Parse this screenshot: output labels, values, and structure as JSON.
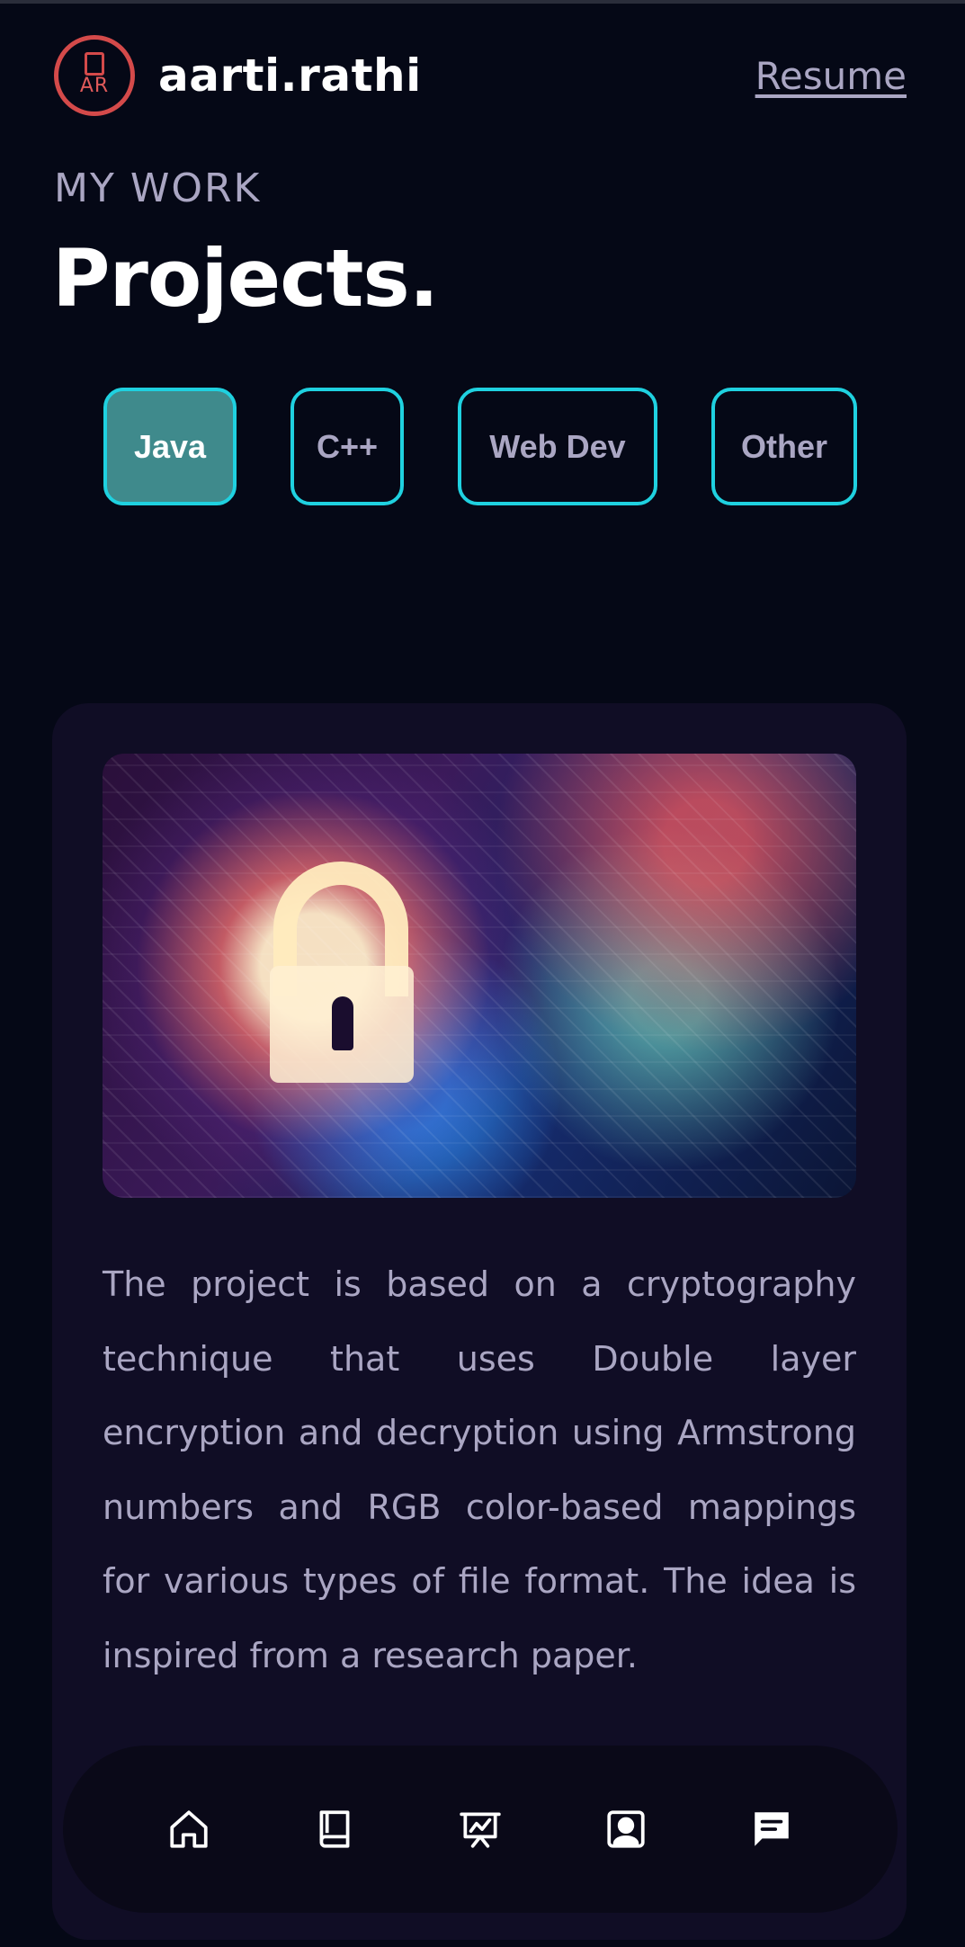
{
  "header": {
    "logo_text": "AR",
    "brand": "aarti.rathi",
    "resume_label": "Resume"
  },
  "section": {
    "subtitle": "MY WORK",
    "title": "Projects."
  },
  "tabs": [
    {
      "label": "Java",
      "active": true
    },
    {
      "label": "C++",
      "active": false
    },
    {
      "label": "Web Dev",
      "active": false
    },
    {
      "label": "Other",
      "active": false
    }
  ],
  "project": {
    "image_icon": "padlock-circuit-icon",
    "description": "The project is based on a cryptography technique that uses Double layer encryption and decryption using Armstrong numbers and RGB color-based mappings for various types of file format. The idea is inspired from a research paper."
  },
  "bottom_nav": {
    "items": [
      {
        "icon": "home-icon"
      },
      {
        "icon": "book-icon"
      },
      {
        "icon": "presentation-chart-icon"
      },
      {
        "icon": "contact-card-icon"
      },
      {
        "icon": "chat-icon"
      }
    ]
  },
  "colors": {
    "background": "#050816",
    "card": "#100d25",
    "accent_border": "#1fd1e0",
    "active_tab": "#3f8a8c",
    "secondary_text": "#aaa6c3",
    "logo": "#d44a4a"
  }
}
